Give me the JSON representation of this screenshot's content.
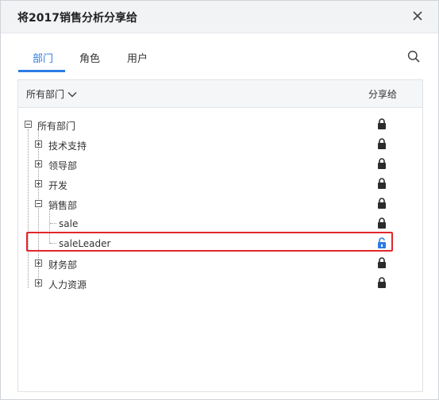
{
  "dialog": {
    "title": "将2017销售分析分享给"
  },
  "tabs": [
    {
      "label": "部门",
      "active": true
    },
    {
      "label": "角色",
      "active": false
    },
    {
      "label": "用户",
      "active": false
    }
  ],
  "panel": {
    "filter_label": "所有部门",
    "share_header": "分享给"
  },
  "tree": [
    {
      "label": "所有部门",
      "toggle": "minus",
      "lock": "locked"
    },
    {
      "label": "技术支持",
      "toggle": "plus",
      "lock": "locked"
    },
    {
      "label": "领导部",
      "toggle": "plus",
      "lock": "locked"
    },
    {
      "label": "开发",
      "toggle": "plus",
      "lock": "locked"
    },
    {
      "label": "销售部",
      "toggle": "minus",
      "lock": "locked"
    },
    {
      "label": "sale",
      "toggle": "none",
      "lock": "locked"
    },
    {
      "label": "saleLeader",
      "toggle": "none",
      "lock": "unlocked",
      "highlighted": true
    },
    {
      "label": "财务部",
      "toggle": "plus",
      "lock": "locked"
    },
    {
      "label": "人力资源",
      "toggle": "plus",
      "lock": "locked"
    }
  ],
  "colors": {
    "accent": "#2d7be5",
    "highlight_border": "#e3262b",
    "lock_locked": "#2b2b2b",
    "lock_unlocked": "#2d7be5"
  },
  "icons": {
    "close": "close-icon",
    "search": "search-icon",
    "filter_chevron": "chevron-down-icon",
    "lock": "lock-icon",
    "unlock": "unlock-icon"
  }
}
